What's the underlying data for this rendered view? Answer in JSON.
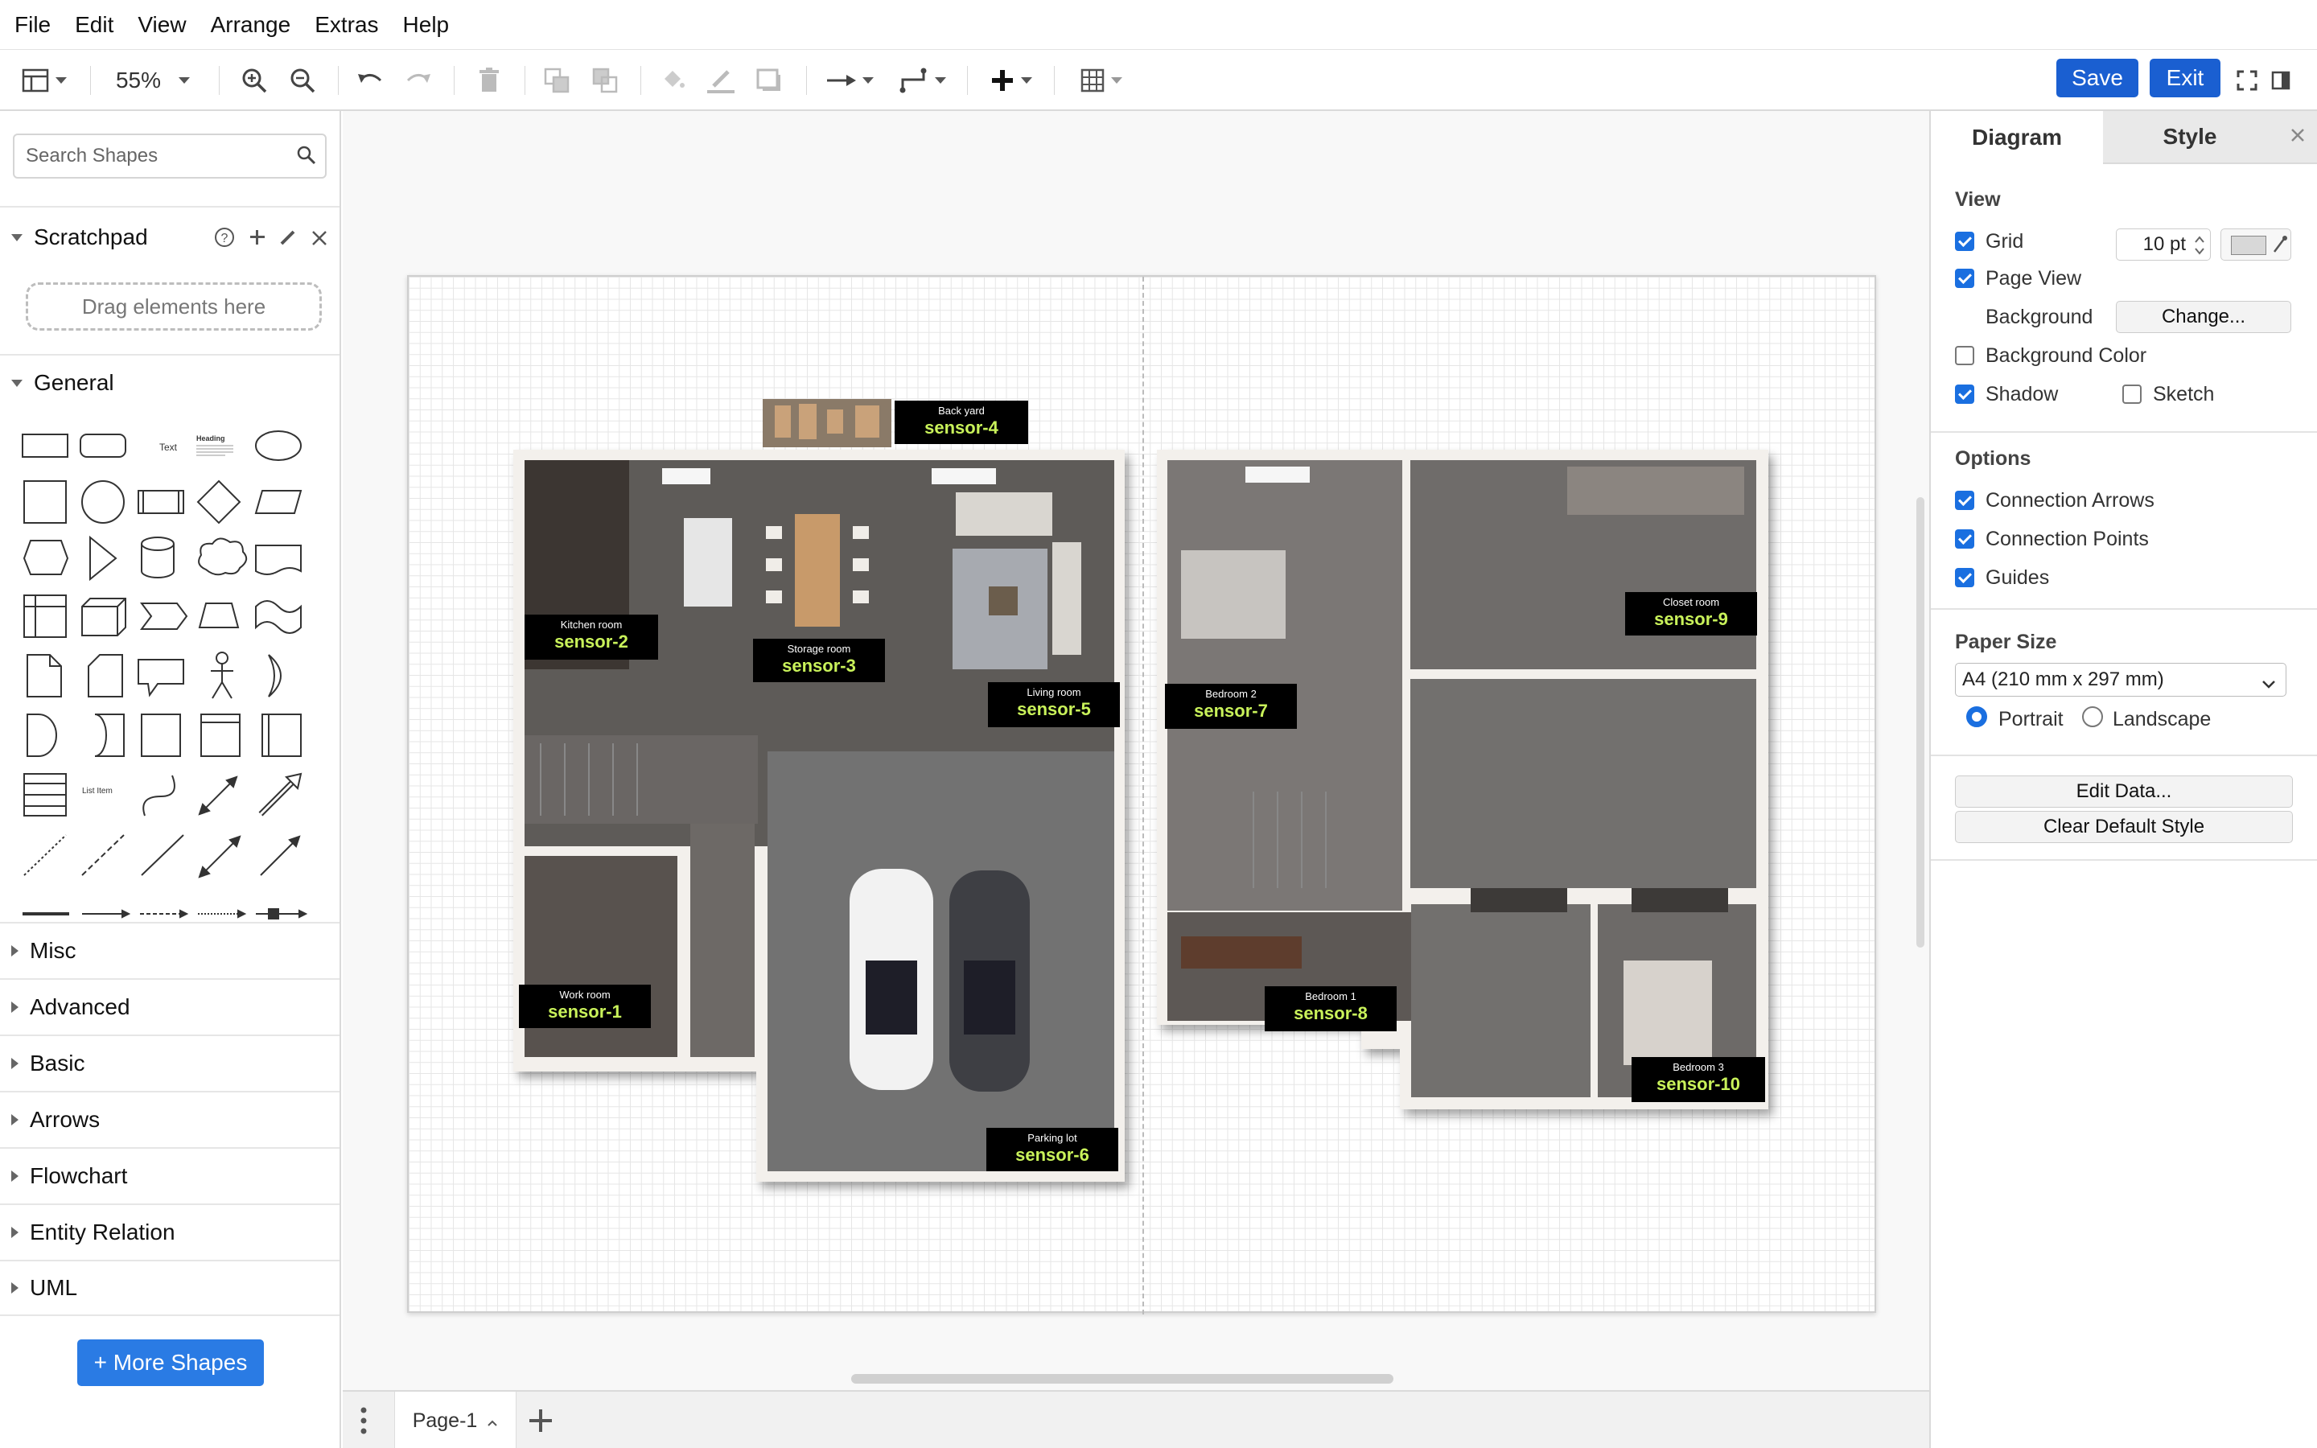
{
  "menubar": {
    "items": [
      "File",
      "Edit",
      "View",
      "Arrange",
      "Extras",
      "Help"
    ]
  },
  "toolbar": {
    "zoom": "55%",
    "save_label": "Save",
    "exit_label": "Exit"
  },
  "sidebar": {
    "search_placeholder": "Search Shapes",
    "scratchpad_title": "Scratchpad",
    "drag_hint": "Drag elements here",
    "general_title": "General",
    "shape_text_label": "Text",
    "shape_heading_label": "Heading",
    "shape_list_label": "List Item",
    "sections": [
      "Misc",
      "Advanced",
      "Basic",
      "Arrows",
      "Flowchart",
      "Entity Relation",
      "UML"
    ],
    "more_shapes": "+ More Shapes"
  },
  "canvas": {
    "sensors": [
      {
        "room": "Back yard",
        "sensor": "sensor-4"
      },
      {
        "room": "Kitchen room",
        "sensor": "sensor-2"
      },
      {
        "room": "Storage room",
        "sensor": "sensor-3"
      },
      {
        "room": "Living room",
        "sensor": "sensor-5"
      },
      {
        "room": "Work room",
        "sensor": "sensor-1"
      },
      {
        "room": "Parking lot",
        "sensor": "sensor-6"
      },
      {
        "room": "Closet room",
        "sensor": "sensor-9"
      },
      {
        "room": "Bedroom 2",
        "sensor": "sensor-7"
      },
      {
        "room": "Bedroom 1",
        "sensor": "sensor-8"
      },
      {
        "room": "Bedroom 3",
        "sensor": "sensor-10"
      }
    ]
  },
  "bottombar": {
    "page_tab": "Page-1"
  },
  "format_panel": {
    "tabs": [
      "Diagram",
      "Style"
    ],
    "view_title": "View",
    "grid_label": "Grid",
    "grid_size": "10 pt",
    "grid_checked": true,
    "page_view_label": "Page View",
    "page_view_checked": true,
    "background_label": "Background",
    "change_button": "Change...",
    "background_color_label": "Background Color",
    "background_color_checked": false,
    "shadow_label": "Shadow",
    "shadow_checked": true,
    "sketch_label": "Sketch",
    "sketch_checked": false,
    "options_title": "Options",
    "connection_arrows_label": "Connection Arrows",
    "connection_points_label": "Connection Points",
    "guides_label": "Guides",
    "paper_size_title": "Paper Size",
    "paper_size_value": "A4 (210 mm x 297 mm)",
    "portrait_label": "Portrait",
    "landscape_label": "Landscape",
    "orientation": "Portrait",
    "edit_data_button": "Edit Data...",
    "clear_style_button": "Clear Default Style"
  },
  "colors": {
    "accent": "#1a5fd1",
    "sensor_text": "#c9f25a",
    "more_shapes": "#2a7be4"
  }
}
